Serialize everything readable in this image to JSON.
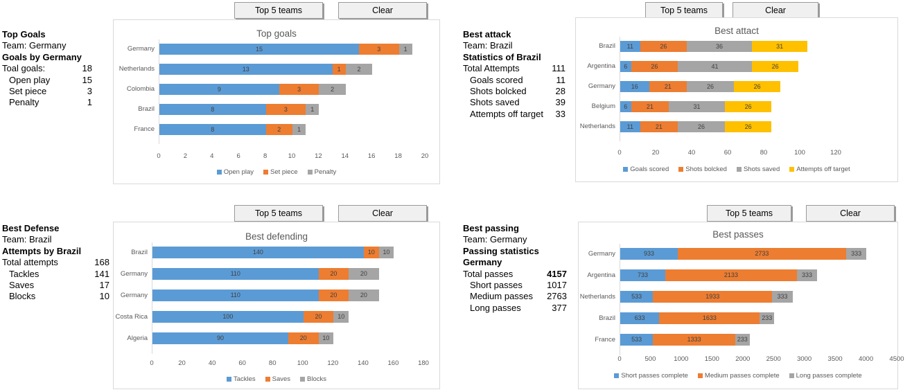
{
  "colors": {
    "blue": "#5B9BD5",
    "orange": "#ED7D31",
    "gray": "#A5A5A5",
    "yellow": "#FFC000",
    "frame": "#D9D9D9",
    "axis_text": "#595959",
    "button_face": "#F0F0F0",
    "button_border": "#9A9A9A"
  },
  "buttons": {
    "top5": "Top 5 teams",
    "clear": "Clear"
  },
  "panels": [
    {
      "name": "top-goals",
      "heading": "Top Goals",
      "team_line": "Team: Germany",
      "subheading": "Goals by Germany",
      "rows": [
        {
          "label": "Toal goals:",
          "value": "18",
          "indent": false,
          "bold_value": false
        },
        {
          "label": "Open play",
          "value": "15",
          "indent": true,
          "bold_value": false
        },
        {
          "label": "Set piece",
          "value": "3",
          "indent": true,
          "bold_value": false
        },
        {
          "label": "Penalty",
          "value": "1",
          "indent": true,
          "bold_value": false
        }
      ]
    },
    {
      "name": "best-attack",
      "heading": "Best attack",
      "team_line": "Team: Brazil",
      "subheading": "Statistics of Brazil",
      "rows": [
        {
          "label": "Total Attempts",
          "value": "111",
          "indent": false,
          "bold_value": false
        },
        {
          "label": "Goals scored",
          "value": "11",
          "indent": true,
          "bold_value": false
        },
        {
          "label": "Shots bolcked",
          "value": "28",
          "indent": true,
          "bold_value": false
        },
        {
          "label": "Shots saved",
          "value": "39",
          "indent": true,
          "bold_value": false
        },
        {
          "label": "Attempts off target",
          "value": "33",
          "indent": true,
          "bold_value": false
        }
      ]
    },
    {
      "name": "best-defense",
      "heading": "Best Defense",
      "team_line": "Team: Brazil",
      "subheading": "Attempts by Brazil",
      "rows": [
        {
          "label": "Total attempts",
          "value": "168",
          "indent": false,
          "bold_value": false
        },
        {
          "label": "Tackles",
          "value": "141",
          "indent": true,
          "bold_value": false
        },
        {
          "label": "Saves",
          "value": "17",
          "indent": true,
          "bold_value": false
        },
        {
          "label": "Blocks",
          "value": "10",
          "indent": true,
          "bold_value": false
        }
      ]
    },
    {
      "name": "best-passing",
      "heading": "Best passing",
      "team_line": "Team: Germany",
      "subheading": "Passing statistics Germany",
      "rows": [
        {
          "label": "Total passes",
          "value": "4157",
          "indent": false,
          "bold_value": true
        },
        {
          "label": "Short passes",
          "value": "1017",
          "indent": true,
          "bold_value": false
        },
        {
          "label": "Medium passes",
          "value": "2763",
          "indent": true,
          "bold_value": false
        },
        {
          "label": "Long passes",
          "value": "377",
          "indent": true,
          "bold_value": false
        }
      ]
    }
  ],
  "chart_data": [
    {
      "id": "top-goals-chart",
      "type": "bar",
      "orientation": "horizontal",
      "stacked": true,
      "title": "Top goals",
      "xlabel": "",
      "ylabel": "",
      "categories": [
        "Germany",
        "Netherlands",
        "Colombia",
        "Brazil",
        "France"
      ],
      "series": [
        {
          "name": "Open play",
          "color": "#5B9BD5",
          "values": [
            15,
            13,
            9,
            8,
            8
          ]
        },
        {
          "name": "Set piece",
          "color": "#ED7D31",
          "values": [
            3,
            1,
            3,
            3,
            2
          ]
        },
        {
          "name": "Penalty",
          "color": "#A5A5A5",
          "values": [
            1,
            2,
            2,
            1,
            1
          ]
        }
      ],
      "xlim": [
        0,
        20
      ],
      "xticks": [
        0,
        2,
        4,
        6,
        8,
        10,
        12,
        14,
        16,
        18,
        20
      ],
      "grid": false,
      "legend_position": "bottom"
    },
    {
      "id": "best-attack-chart",
      "type": "bar",
      "orientation": "horizontal",
      "stacked": true,
      "title": "Best attact",
      "xlabel": "",
      "ylabel": "",
      "categories": [
        "Brazil",
        "Argentina",
        "Germany",
        "Belgium",
        "Netherlands"
      ],
      "series": [
        {
          "name": "Goals scored",
          "color": "#5B9BD5",
          "values": [
            11,
            6,
            16,
            6,
            11
          ]
        },
        {
          "name": "Shots bolcked",
          "color": "#ED7D31",
          "values": [
            26,
            26,
            21,
            21,
            21
          ]
        },
        {
          "name": "Shots saved",
          "color": "#A5A5A5",
          "values": [
            36,
            41,
            26,
            31,
            26
          ]
        },
        {
          "name": "Attempts off target",
          "color": "#FFC000",
          "values": [
            31,
            26,
            26,
            26,
            26
          ]
        }
      ],
      "xlim": [
        0,
        120
      ],
      "xticks": [
        0,
        20,
        40,
        60,
        80,
        100,
        120
      ],
      "grid": false,
      "legend_position": "bottom"
    },
    {
      "id": "best-defending-chart",
      "type": "bar",
      "orientation": "horizontal",
      "stacked": true,
      "title": "Best defending",
      "xlabel": "",
      "ylabel": "",
      "categories": [
        "Brazil",
        "Germany",
        "Germany",
        "Costa Rica",
        "Algeria"
      ],
      "series": [
        {
          "name": "Tackles",
          "color": "#5B9BD5",
          "values": [
            140,
            110,
            110,
            100,
            90
          ]
        },
        {
          "name": "Saves",
          "color": "#ED7D31",
          "values": [
            10,
            20,
            20,
            20,
            20
          ]
        },
        {
          "name": "Blocks",
          "color": "#A5A5A5",
          "values": [
            10,
            20,
            20,
            10,
            10
          ]
        }
      ],
      "xlim": [
        0,
        180
      ],
      "xticks": [
        0,
        20,
        40,
        60,
        80,
        100,
        120,
        140,
        160,
        180
      ],
      "grid": false,
      "legend_position": "bottom"
    },
    {
      "id": "best-passes-chart",
      "type": "bar",
      "orientation": "horizontal",
      "stacked": true,
      "title": "Best passes",
      "xlabel": "",
      "ylabel": "",
      "categories": [
        "Germany",
        "Argentina",
        "Netherlands",
        "Brazil",
        "France"
      ],
      "series": [
        {
          "name": "Short passes complete",
          "color": "#5B9BD5",
          "values": [
            933,
            733,
            533,
            633,
            533
          ]
        },
        {
          "name": "Medium passes complete",
          "color": "#ED7D31",
          "values": [
            2733,
            2133,
            1933,
            1633,
            1333
          ]
        },
        {
          "name": "Long passes complete",
          "color": "#A5A5A5",
          "values": [
            333,
            333,
            333,
            233,
            233
          ]
        }
      ],
      "xlim": [
        0,
        4500
      ],
      "xticks": [
        0,
        500,
        1000,
        1500,
        2000,
        2500,
        3000,
        3500,
        4000,
        4500
      ],
      "grid": false,
      "legend_position": "bottom"
    }
  ]
}
